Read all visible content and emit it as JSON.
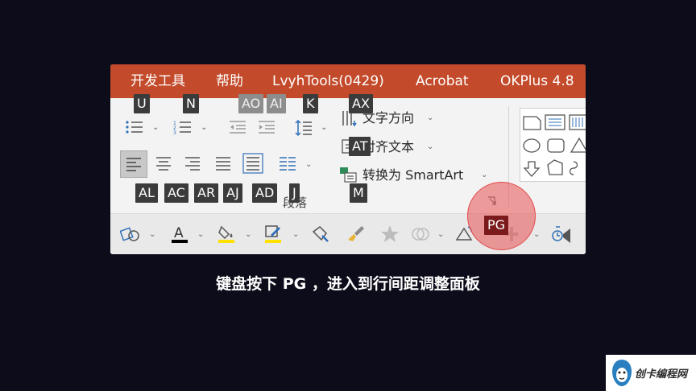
{
  "tabs": [
    "开发工具",
    "帮助",
    "LvyhTools(0429)",
    "Acrobat",
    "OKPlus 4.8"
  ],
  "keytips": {
    "bullets": "U",
    "numbering": "N",
    "decrease_indent": "AO",
    "increase_indent": "AI",
    "line_spacing": "K",
    "text_direction": "AX",
    "align_text": "AT",
    "align_left": "AL",
    "align_center": "AC",
    "align_right": "AR",
    "justify": "AJ",
    "distributed": "AD",
    "columns": "J",
    "smartart": "M",
    "paragraph_launcher": "PG"
  },
  "ribbon": {
    "text_direction_label": "文字方向",
    "align_text_label": "对齐文本",
    "smartart_label": "转换为 SmartArt",
    "group_label": "段落"
  },
  "caption": "键盘按下 PG ，进入到行间距调整面板",
  "watermark": "创卡编程网",
  "colors": {
    "tab_bar": "#c34a2a",
    "background": "#0d0c1a",
    "highlight": "#e34a4a",
    "keytip": "#3b3b3b",
    "font_color_bar": "#000000",
    "highlight_color_bar": "#ffe100"
  }
}
